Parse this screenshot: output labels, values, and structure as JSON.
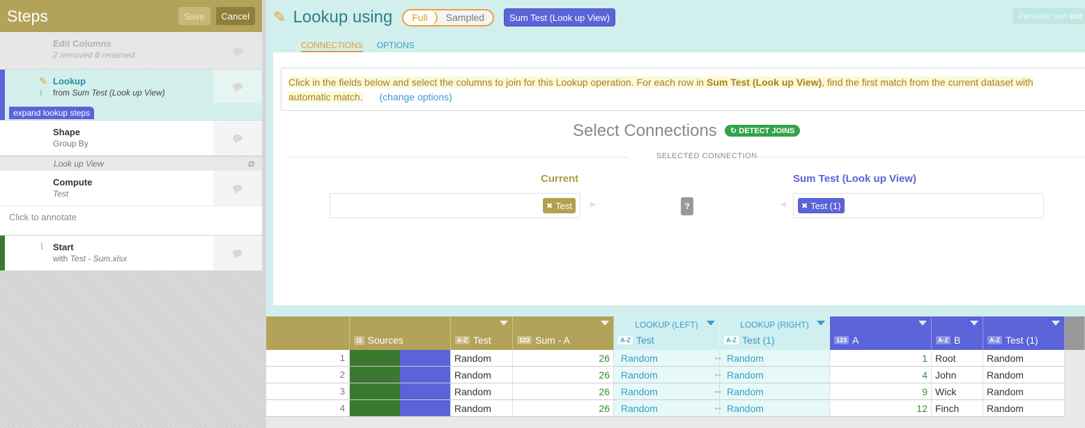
{
  "steps_panel": {
    "title": "Steps",
    "save_label": "Save",
    "cancel_label": "Cancel",
    "steps": [
      {
        "name": "Edit Columns",
        "removed_count": "2",
        "removed_label": "removed",
        "renamed_count": "0",
        "renamed_label": "renamed"
      },
      {
        "name": "Lookup",
        "sub_prefix": "from",
        "sub_value": "Sum Test (Look up View)",
        "expand_label": "expand lookup steps"
      },
      {
        "name": "Shape",
        "sub": "Group By"
      },
      {
        "name": "Look up View"
      },
      {
        "name": "Compute",
        "sub": "Test"
      },
      {
        "name": "Start",
        "sub_prefix": "with",
        "sub_value": "Test - Sum.xlsx"
      }
    ],
    "annotate_placeholder": "Click to annotate"
  },
  "header": {
    "title": "Lookup using",
    "mode_full": "Full",
    "mode_sampled": "Sampled",
    "view_button": "Sum Test (Look up View)",
    "sort_prefix": "Personal sort",
    "sort_bold": "not prese"
  },
  "tabs": [
    "CONNECTIONS",
    "OPTIONS"
  ],
  "info": {
    "part1": "Click in the fields below and select the columns to join for this Lookup operation.   For each row in",
    "view_name": "Sum Test (Look up View)",
    "part2": ", find the first match from the current dataset with",
    "part3": "automatic match.",
    "change_link": "(change options)"
  },
  "connections": {
    "title": "Select Connections",
    "detect_label": "DETECT JOINS",
    "selected_label": "SELECTED CONNECTION",
    "current_heading": "Current",
    "current_chip": "Test",
    "other_heading": "Sum Test (Look up View)",
    "other_chip": "Test (1)",
    "question": "?"
  },
  "grid": {
    "columns": [
      {
        "top": "",
        "type": "",
        "name": ""
      },
      {
        "top": "",
        "type": "",
        "name": "Sources"
      },
      {
        "top": "",
        "type": "A-Z",
        "name": "Test"
      },
      {
        "top": "",
        "type": "123",
        "name": "Sum - A"
      },
      {
        "top": "LOOKUP (LEFT)",
        "type": "A-Z",
        "name": "Test"
      },
      {
        "top": "LOOKUP (RIGHT)",
        "type": "A-Z",
        "name": "Test (1)"
      },
      {
        "top": "",
        "type": "123",
        "name": "A"
      },
      {
        "top": "",
        "type": "A-Z",
        "name": "B"
      },
      {
        "top": "",
        "type": "A-Z",
        "name": "Test (1)"
      }
    ],
    "rows": [
      {
        "n": "1",
        "test": "Random",
        "sum": "26",
        "left": "Random",
        "right": "Random",
        "a": "1",
        "b": "Root",
        "t1": "Random"
      },
      {
        "n": "2",
        "test": "Random",
        "sum": "26",
        "left": "Random",
        "right": "Random",
        "a": "4",
        "b": "John",
        "t1": "Random"
      },
      {
        "n": "3",
        "test": "Random",
        "sum": "26",
        "left": "Random",
        "right": "Random",
        "a": "9",
        "b": "Wick",
        "t1": "Random"
      },
      {
        "n": "4",
        "test": "Random",
        "sum": "26",
        "left": "Random",
        "right": "Random",
        "a": "12",
        "b": "Finch",
        "t1": "Random"
      }
    ]
  },
  "colors": {
    "gold": "#b3a25a",
    "teal": "#d1efed",
    "indigo": "#5a63d8",
    "green": "#3a7a30",
    "orange": "#e59a2a"
  }
}
